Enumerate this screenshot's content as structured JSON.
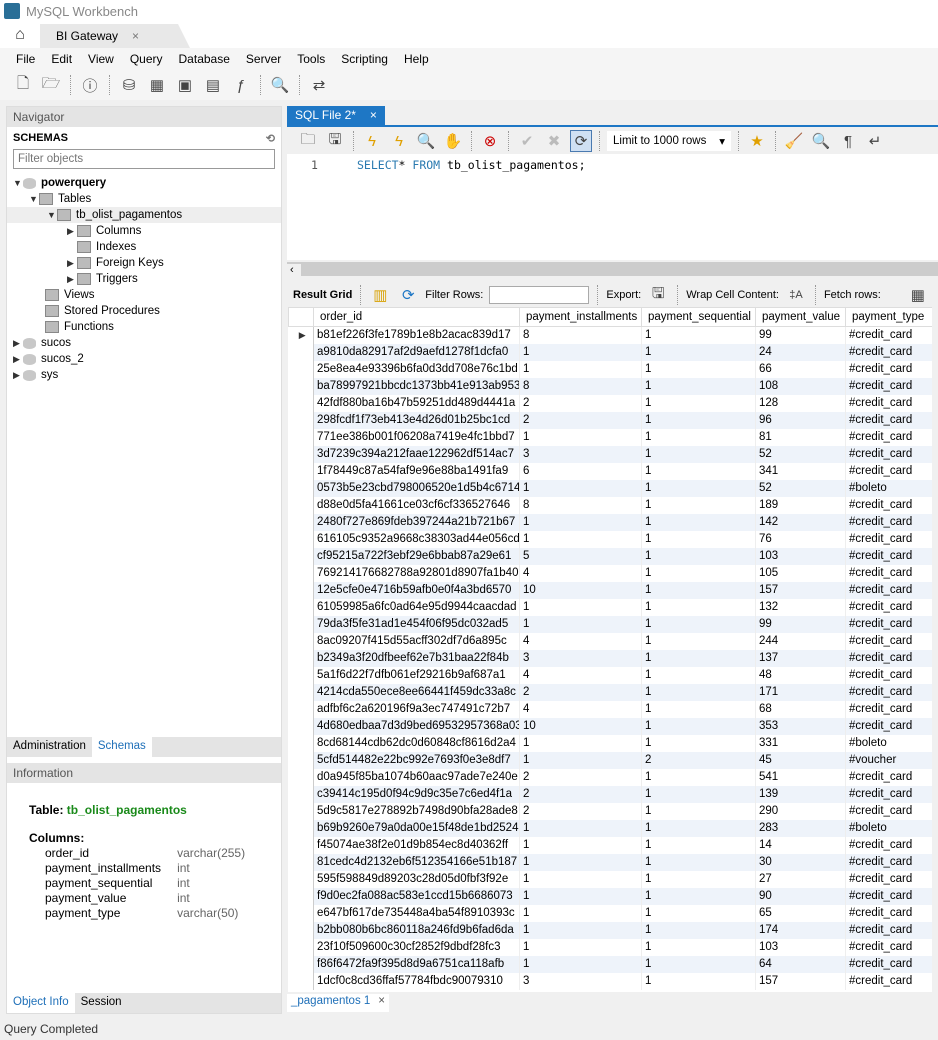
{
  "app": {
    "title": "MySQL Workbench",
    "connection_tab": "BI Gateway"
  },
  "menu": [
    "File",
    "Edit",
    "View",
    "Query",
    "Database",
    "Server",
    "Tools",
    "Scripting",
    "Help"
  ],
  "navigator": {
    "header": "Navigator",
    "schemas_label": "SCHEMAS",
    "filter_placeholder": "Filter objects",
    "tree": {
      "db": "powerquery",
      "tables": "Tables",
      "table": "tb_olist_pagamentos",
      "columns": "Columns",
      "indexes": "Indexes",
      "fks": "Foreign Keys",
      "triggers": "Triggers",
      "views": "Views",
      "procs": "Stored Procedures",
      "funcs": "Functions",
      "others": [
        "sucos",
        "sucos_2",
        "sys"
      ]
    },
    "tabs": [
      "Administration",
      "Schemas"
    ]
  },
  "information": {
    "header": "Information",
    "table_label": "Table:",
    "table_name": "tb_olist_pagamentos",
    "columns_label": "Columns:",
    "columns": [
      [
        "order_id",
        "varchar(255)"
      ],
      [
        "payment_installments",
        "int"
      ],
      [
        "payment_sequential",
        "int"
      ],
      [
        "payment_value",
        "int"
      ],
      [
        "payment_type",
        "varchar(50)"
      ]
    ],
    "tabs": [
      "Object Info",
      "Session"
    ]
  },
  "editor": {
    "tab": "SQL File 2*",
    "limit": "Limit to 1000 rows",
    "line": "1",
    "kw1": "SELECT",
    "rest1": "* ",
    "kw2": "FROM",
    "rest2": " tb_olist_pagamentos;"
  },
  "result_toolbar": {
    "result_grid": "Result Grid",
    "filter_rows": "Filter Rows:",
    "export": "Export:",
    "wrap": "Wrap Cell Content:",
    "fetch": "Fetch rows:"
  },
  "result_tab": "_pagamentos 1",
  "grid": {
    "columns": [
      "order_id",
      "payment_installments",
      "payment_sequential",
      "payment_value",
      "payment_type"
    ],
    "rows": [
      [
        "b81ef226f3fe1789b1e8b2acac839d17",
        "8",
        "1",
        "99",
        "#credit_card"
      ],
      [
        "a9810da82917af2d9aefd1278f1dcfa0",
        "1",
        "1",
        "24",
        "#credit_card"
      ],
      [
        "25e8ea4e93396b6fa0d3dd708e76c1bd",
        "1",
        "1",
        "66",
        "#credit_card"
      ],
      [
        "ba78997921bbcdc1373bb41e913ab953",
        "8",
        "1",
        "108",
        "#credit_card"
      ],
      [
        "42fdf880ba16b47b59251dd489d4441a",
        "2",
        "1",
        "128",
        "#credit_card"
      ],
      [
        "298fcdf1f73eb413e4d26d01b25bc1cd",
        "2",
        "1",
        "96",
        "#credit_card"
      ],
      [
        "771ee386b001f06208a7419e4fc1bbd7",
        "1",
        "1",
        "81",
        "#credit_card"
      ],
      [
        "3d7239c394a212faae122962df514ac7",
        "3",
        "1",
        "52",
        "#credit_card"
      ],
      [
        "1f78449c87a54faf9e96e88ba1491fa9",
        "6",
        "1",
        "341",
        "#credit_card"
      ],
      [
        "0573b5e23cbd798006520e1d5b4c6714",
        "1",
        "1",
        "52",
        "#boleto"
      ],
      [
        "d88e0d5fa41661ce03cf6cf336527646",
        "8",
        "1",
        "189",
        "#credit_card"
      ],
      [
        "2480f727e869fdeb397244a21b721b67",
        "1",
        "1",
        "142",
        "#credit_card"
      ],
      [
        "616105c9352a9668c38303ad44e056cd",
        "1",
        "1",
        "76",
        "#credit_card"
      ],
      [
        "cf95215a722f3ebf29e6bbab87a29e61",
        "5",
        "1",
        "103",
        "#credit_card"
      ],
      [
        "769214176682788a92801d8907fa1b40",
        "4",
        "1",
        "105",
        "#credit_card"
      ],
      [
        "12e5cfe0e4716b59afb0e0f4a3bd6570",
        "10",
        "1",
        "157",
        "#credit_card"
      ],
      [
        "61059985a6fc0ad64e95d9944caacdad",
        "1",
        "1",
        "132",
        "#credit_card"
      ],
      [
        "79da3f5fe31ad1e454f06f95dc032ad5",
        "1",
        "1",
        "99",
        "#credit_card"
      ],
      [
        "8ac09207f415d55acff302df7d6a895c",
        "4",
        "1",
        "244",
        "#credit_card"
      ],
      [
        "b2349a3f20dfbeef62e7b31baa22f84b",
        "3",
        "1",
        "137",
        "#credit_card"
      ],
      [
        "5a1f6d22f7dfb061ef29216b9af687a1",
        "4",
        "1",
        "48",
        "#credit_card"
      ],
      [
        "4214cda550ece8ee66441f459dc33a8c",
        "2",
        "1",
        "171",
        "#credit_card"
      ],
      [
        "adfbf6c2a620196f9a3ec747491c72b7",
        "4",
        "1",
        "68",
        "#credit_card"
      ],
      [
        "4d680edbaa7d3d9bed69532957368a03",
        "10",
        "1",
        "353",
        "#credit_card"
      ],
      [
        "8cd68144cdb62dc0d60848cf8616d2a4",
        "1",
        "1",
        "331",
        "#boleto"
      ],
      [
        "5cfd514482e22bc992e7693f0e3e8df7",
        "1",
        "2",
        "45",
        "#voucher"
      ],
      [
        "d0a945f85ba1074b60aac97ade7e240e",
        "2",
        "1",
        "541",
        "#credit_card"
      ],
      [
        "c39414c195d0f94c9d9c35e7c6ed4f1a",
        "2",
        "1",
        "139",
        "#credit_card"
      ],
      [
        "5d9c5817e278892b7498d90bfa28ade8",
        "2",
        "1",
        "290",
        "#credit_card"
      ],
      [
        "b69b9260e79a0da00e15f48de1bd2524",
        "1",
        "1",
        "283",
        "#boleto"
      ],
      [
        "f45074ae38f2e01d9b854ec8d40362ff",
        "1",
        "1",
        "14",
        "#credit_card"
      ],
      [
        "81cedc4d2132eb6f512354166e51b187",
        "1",
        "1",
        "30",
        "#credit_card"
      ],
      [
        "595f598849d89203c28d05d0fbf3f92e",
        "1",
        "1",
        "27",
        "#credit_card"
      ],
      [
        "f9d0ec2fa088ac583e1ccd15b6686073",
        "1",
        "1",
        "90",
        "#credit_card"
      ],
      [
        "e647bf617de735448a4ba54f8910393c",
        "1",
        "1",
        "65",
        "#credit_card"
      ],
      [
        "b2bb080b6bc860118a246fd9b6fad6da",
        "1",
        "1",
        "174",
        "#credit_card"
      ],
      [
        "23f10f509600c30cf2852f9dbdf28fc3",
        "1",
        "1",
        "103",
        "#credit_card"
      ],
      [
        "f86f6472fa9f395d8d9a6751ca118afb",
        "1",
        "1",
        "64",
        "#credit_card"
      ],
      [
        "1dcf0c8cd36ffaf57784fbdc90079310",
        "3",
        "1",
        "157",
        "#credit_card"
      ]
    ]
  },
  "status": "Query Completed",
  "colors": {
    "accent": "#1e77c5",
    "keyword": "#2a7ab0",
    "info_table": "#1a8a1a"
  }
}
